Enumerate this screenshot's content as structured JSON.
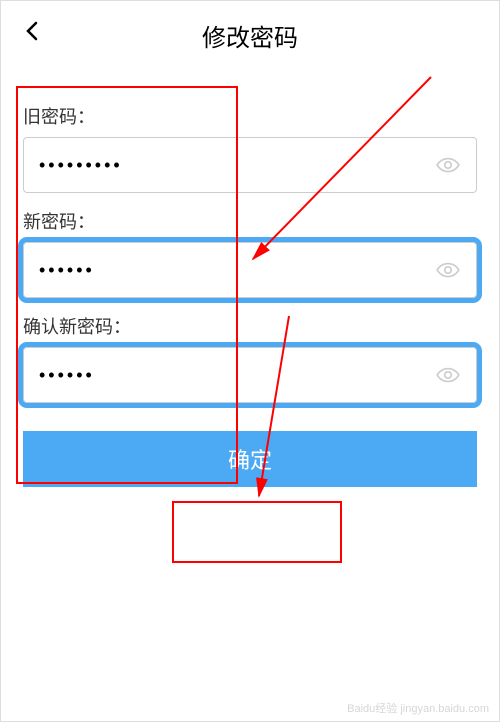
{
  "header": {
    "title": "修改密码"
  },
  "form": {
    "oldPassword": {
      "label": "旧密码：",
      "value": "•••••••••"
    },
    "newPassword": {
      "label": "新密码：",
      "value": "••••••"
    },
    "confirmPassword": {
      "label": "确认新密码：",
      "value": "••••••"
    },
    "submitLabel": "确定"
  },
  "watermark": "Baidu经验 jingyan.baidu.com"
}
